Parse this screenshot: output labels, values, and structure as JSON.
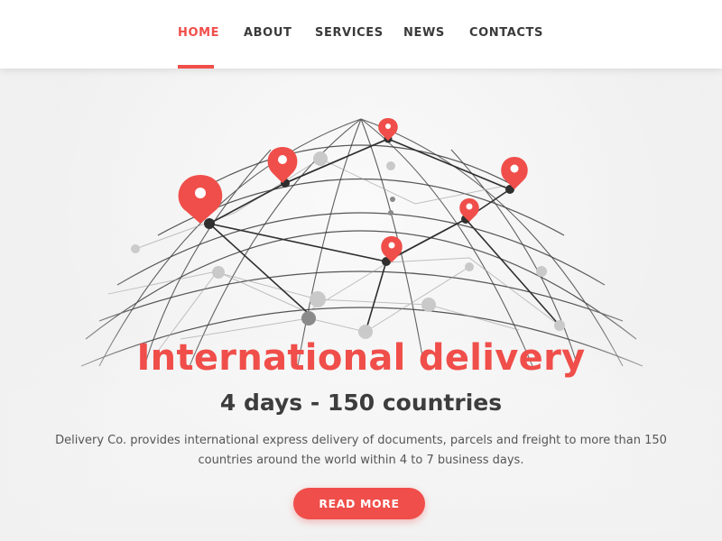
{
  "nav": {
    "items": [
      {
        "label": "HOME",
        "active": true
      },
      {
        "label": "ABOUT",
        "active": false
      },
      {
        "label": "SERVICES",
        "active": false
      },
      {
        "label": "NEWS",
        "active": false
      },
      {
        "label": "CONTACTS",
        "active": false
      }
    ]
  },
  "hero": {
    "title": "International delivery",
    "subtitle": "4 days - 150 countries",
    "description": "Delivery Co. provides international express delivery of documents, parcels and freight to more than 150 countries around the world within 4 to 7 business days.",
    "cta_label": "READ MORE",
    "graphic_icon": "globe-network-with-location-pins"
  },
  "colors": {
    "accent": "#f04e4a",
    "nav_text": "#3a3a3a",
    "subtitle_text": "#3d3d3d",
    "body_text": "#555555",
    "hero_background": "#f1f1f1"
  }
}
